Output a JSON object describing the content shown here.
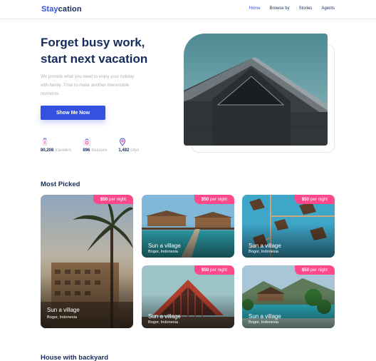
{
  "brand": {
    "part1": "Stay",
    "part2": "cation"
  },
  "nav": [
    {
      "label": "Home",
      "active": true
    },
    {
      "label": "Browse by",
      "active": false
    },
    {
      "label": "Stories",
      "active": false
    },
    {
      "label": "Agents",
      "active": false
    }
  ],
  "hero": {
    "title": "Forget busy work,\nstart  next vacation",
    "description": "We provide what you need to enjoy your holiday with family. Time to make another memorable moments.",
    "cta_label": "Show Me Now",
    "stats": [
      {
        "icon": "traveler-icon",
        "number": "80,208",
        "label": "travelers"
      },
      {
        "icon": "camera-icon",
        "number": "896",
        "label": "treasure"
      },
      {
        "icon": "location-pin-icon",
        "number": "1,492",
        "label": "citys"
      }
    ]
  },
  "most_picked": {
    "title": "Most Picked",
    "cards": [
      {
        "price": "$50",
        "unit": "per night",
        "name": "Sun a village",
        "location": "Bogor, Indonesia",
        "image": "palm-hotel"
      },
      {
        "price": "$50",
        "unit": "per night",
        "name": "Sun a village",
        "location": "Bogor, Indonesia",
        "image": "water-bungalows"
      },
      {
        "price": "$50",
        "unit": "per night",
        "name": "Sun a village",
        "location": "Bogor, Indonesia",
        "image": "aerial-huts"
      },
      {
        "price": "$50",
        "unit": "per night",
        "name": "Sun a village",
        "location": "Bogor, Indonesia",
        "image": "red-house"
      },
      {
        "price": "$50",
        "unit": "per night",
        "name": "Sun a village",
        "location": "Bogor, Indonesia",
        "image": "resort-pool"
      }
    ]
  },
  "next_section": {
    "title": "House with backyard"
  },
  "colors": {
    "primary": "#3252df",
    "navy": "#152c5b",
    "muted": "#b0b0b0",
    "badge": "#ff498b"
  }
}
